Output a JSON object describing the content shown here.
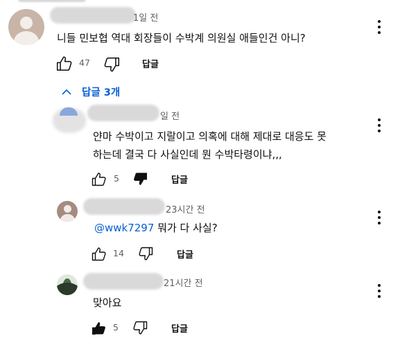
{
  "top_comment": {
    "time": "1일 전",
    "text": "니들 민보협 역대 회장들이 수박계 의원실 애들인건 아니?",
    "likes": "47",
    "reply_label": "답글"
  },
  "replies_toggle": {
    "label": "답글 3개"
  },
  "replies": [
    {
      "time": "일 전",
      "text_line1": "얀마 수박이고 지랄이고 의혹에 대해 제대로 대응도 못",
      "text_line2": "하는데 결국 다 사실인데 뭔 수박타령이냐,,,",
      "likes": "5",
      "reply_label": "답글"
    },
    {
      "time": "23시간 전",
      "mention": "@wwk7297",
      "text": " 뭐가 다 사실?",
      "likes": "14",
      "reply_label": "답글"
    },
    {
      "time": "21시간 전",
      "text": "맞아요",
      "likes": "5",
      "reply_label": "답글"
    }
  ],
  "icons": {
    "like": "thumb-up-icon",
    "dislike": "thumb-down-icon",
    "menu": "kebab-menu-icon",
    "collapse": "chevron-up-icon"
  },
  "colors": {
    "link": "#065fd4",
    "text": "#0f0f0f",
    "meta": "#606060"
  }
}
